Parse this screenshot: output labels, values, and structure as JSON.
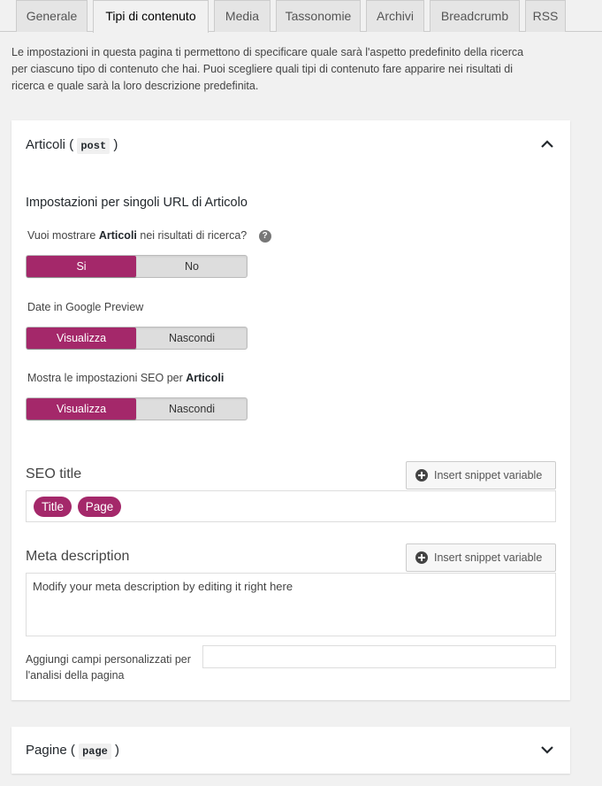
{
  "tabs": [
    {
      "label": "Generale"
    },
    {
      "label": "Tipi di contenuto"
    },
    {
      "label": "Media"
    },
    {
      "label": "Tassonomie"
    },
    {
      "label": "Archivi"
    },
    {
      "label": "Breadcrumb"
    },
    {
      "label": "RSS"
    }
  ],
  "intro": "Le impostazioni in questa pagina ti permettono di specificare quale sarà l'aspetto predefinito della ricerca per ciascuno tipo di contenuto che hai. Puoi scegliere quali tipi di contenuto fare apparire nei risultati di ricerca e quale sarà la loro descrizione predefinita.",
  "articoli": {
    "title": "Articoli",
    "slug": "post",
    "open_paren": "(",
    "close_paren": ")",
    "section_heading": "Impostazioni per singoli URL di Articolo",
    "q1_prefix": "Vuoi mostrare ",
    "q1_bold": "Articoli",
    "q1_suffix": " nei risultati di ricerca?",
    "q1_help": "?",
    "q1_on": "Si",
    "q1_off": "No",
    "q2": "Date in Google Preview",
    "q2_on": "Visualizza",
    "q2_off": "Nascondi",
    "q3_prefix": "Mostra le impostazioni SEO per ",
    "q3_bold": "Articoli",
    "q3_on": "Visualizza",
    "q3_off": "Nascondi",
    "seo_title_label": "SEO title",
    "insert_snippet": "Insert snippet variable",
    "seo_pills": [
      "Title",
      "Page"
    ],
    "meta_label": "Meta description",
    "meta_placeholder": "Modify your meta description by editing it right here",
    "custom_fields_label": "Aggiungi campi personalizzati per l'analisi della pagina",
    "custom_fields_value": ""
  },
  "pagine": {
    "title": "Pagine",
    "slug": "page",
    "open_paren": "(",
    "close_paren": ")"
  },
  "colors": {
    "accent": "#a4286a"
  }
}
